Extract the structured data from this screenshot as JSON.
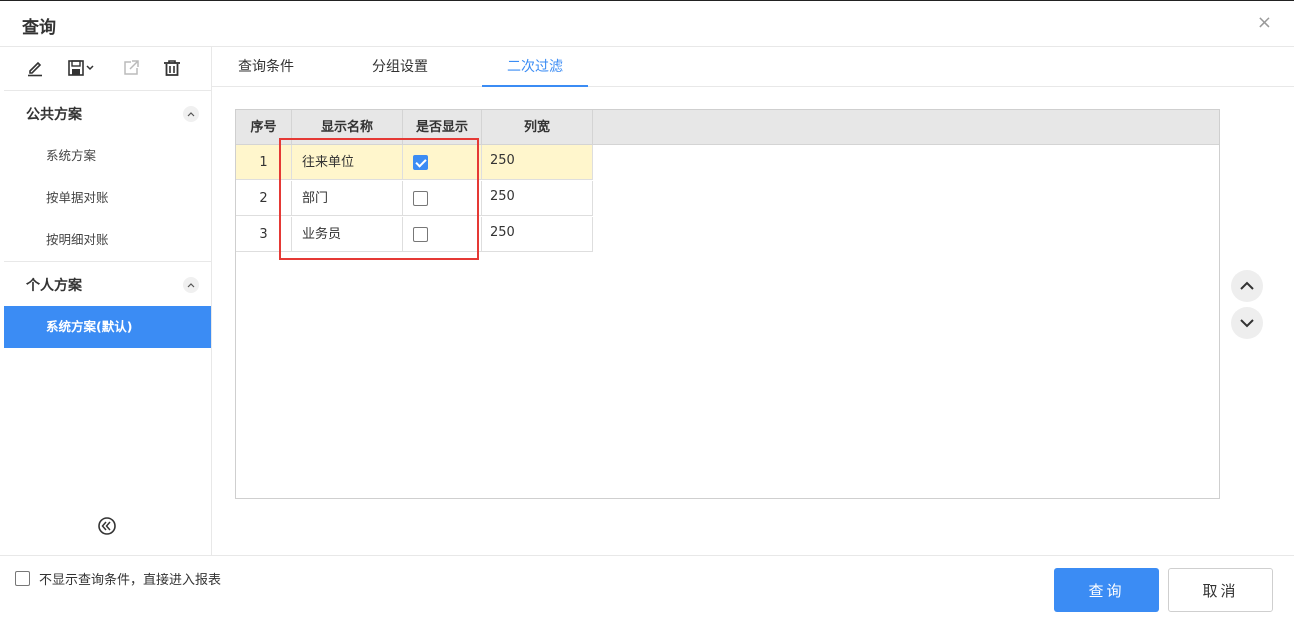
{
  "dialog": {
    "title": "查询",
    "close_symbol": "×"
  },
  "toolbar": {
    "icons": [
      "edit-icon",
      "save-icon",
      "export-icon",
      "delete-icon"
    ]
  },
  "schemes": {
    "public": {
      "label": "公共方案",
      "items": [
        "系统方案",
        "按单据对账",
        "按明细对账"
      ]
    },
    "personal": {
      "label": "个人方案",
      "items": [
        "系统方案(默认)"
      ],
      "active_index": 0
    }
  },
  "tabs": [
    {
      "label": "查询条件",
      "active": false
    },
    {
      "label": "分组设置",
      "active": false
    },
    {
      "label": "二次过滤",
      "active": true
    }
  ],
  "grid": {
    "columns": [
      "序号",
      "显示名称",
      "是否显示",
      "列宽"
    ],
    "rows": [
      {
        "index": "1",
        "name": "往来单位",
        "show": true,
        "width": "250",
        "selected": true
      },
      {
        "index": "2",
        "name": "部门",
        "show": false,
        "width": "250",
        "selected": false
      },
      {
        "index": "3",
        "name": "业务员",
        "show": false,
        "width": "250",
        "selected": false
      }
    ]
  },
  "footer": {
    "skip_conditions_label": "不显示查询条件，直接进入报表",
    "skip_conditions_checked": false,
    "query_button": "查询",
    "cancel_button": "取消"
  },
  "colors": {
    "accent": "#3b8cf4",
    "selected_row": "#fff6cc",
    "highlight": "#e53935"
  }
}
